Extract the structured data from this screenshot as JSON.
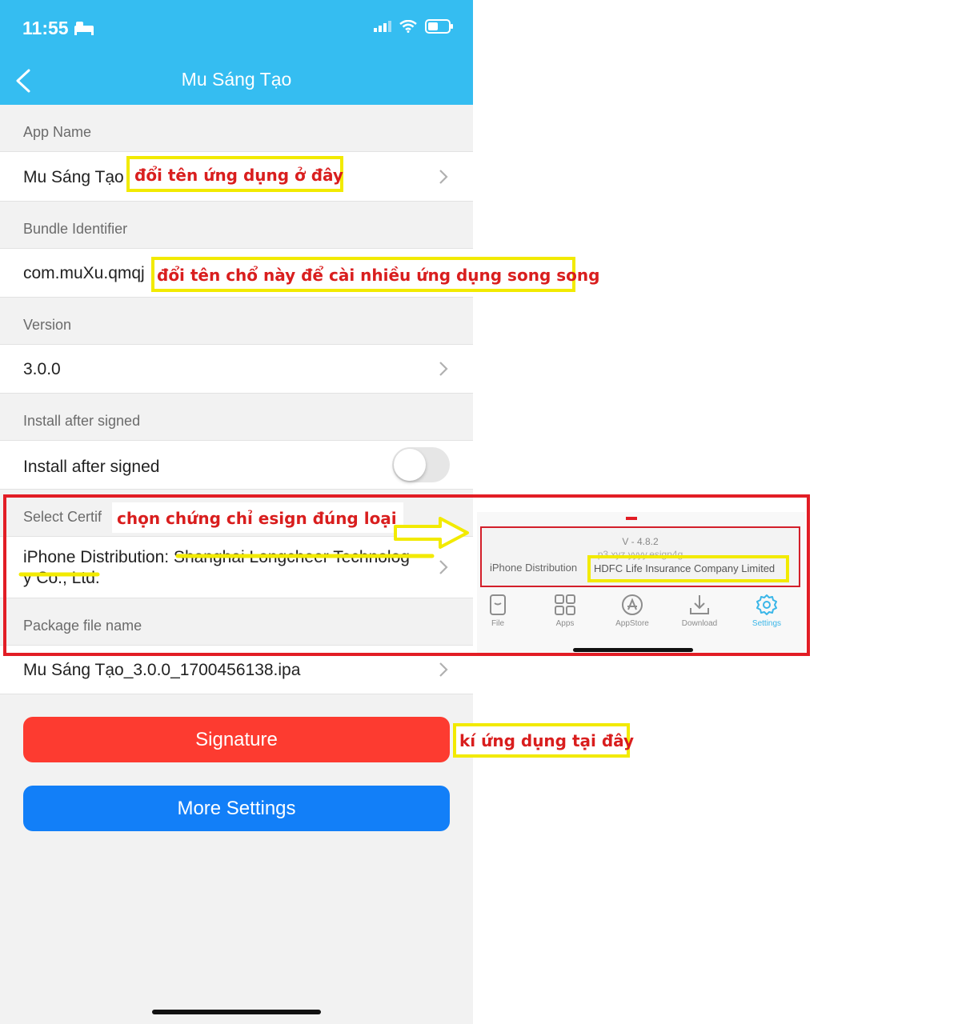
{
  "status_bar": {
    "time": "11:55"
  },
  "nav": {
    "title": "Mu Sáng Tạo"
  },
  "sections": {
    "app_name": "App Name",
    "bundle": "Bundle Identifier",
    "version": "Version",
    "install": "Install after signed",
    "certificate": "Select Certif",
    "package": "Package file name"
  },
  "rows": {
    "app_name": "Mu Sáng Tạo",
    "bundle": "com.muXu.qmqj",
    "version": "3.0.0",
    "install": "Install after signed",
    "install_enabled": false,
    "certificate_line1": "iPhone Distribution: Shanghai Longcheer Technolog",
    "certificate_line2": "y Co., Ltd.",
    "package": "Mu Sáng Tạo_3.0.0_1700456138.ipa"
  },
  "buttons": {
    "signature": "Signature",
    "more_settings": "More Settings"
  },
  "annotations": {
    "rename_app": "đổi tên ứng dụng ở đây",
    "rename_bundle": "đổi tên chổ này để cài nhiều ứng dụng song song",
    "choose_cert": "chọn chứng chỉ esign đúng loại",
    "sign_here": "kí ứng dụng tại đây"
  },
  "inset": {
    "version": "V - 4.8.2",
    "blurred_text": "p3.xyz.yyyy.esign4g",
    "distribution": "iPhone Distribution",
    "company": "HDFC Life Insurance Company Limited",
    "tabs": [
      {
        "label": "File",
        "icon": "file-icon"
      },
      {
        "label": "Apps",
        "icon": "apps-grid-icon"
      },
      {
        "label": "AppStore",
        "icon": "appstore-icon"
      },
      {
        "label": "Download",
        "icon": "download-icon"
      },
      {
        "label": "Settings",
        "icon": "settings-gear-icon",
        "active": true
      }
    ]
  },
  "colors": {
    "header": "#35bdf1",
    "signature_button": "#fd3b30",
    "more_settings_button": "#127ff8",
    "annotation_text": "#d91e1e",
    "highlight_box": "#f2ea00",
    "inset_frame": "#e21d25"
  }
}
